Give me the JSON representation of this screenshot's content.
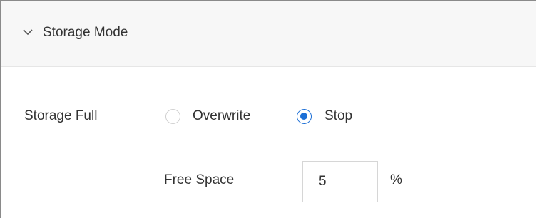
{
  "panel": {
    "title": "Storage Mode",
    "expanded": true,
    "toggle_icon": "chevron-down-icon"
  },
  "storage_full": {
    "label": "Storage Full",
    "options": [
      {
        "label": "Overwrite",
        "selected": false
      },
      {
        "label": "Stop",
        "selected": true
      }
    ]
  },
  "free_space": {
    "label": "Free Space",
    "value": "5",
    "unit": "%"
  },
  "colors": {
    "accent": "#1c6fd6",
    "header_bg": "#f7f7f7",
    "text": "#333333"
  }
}
